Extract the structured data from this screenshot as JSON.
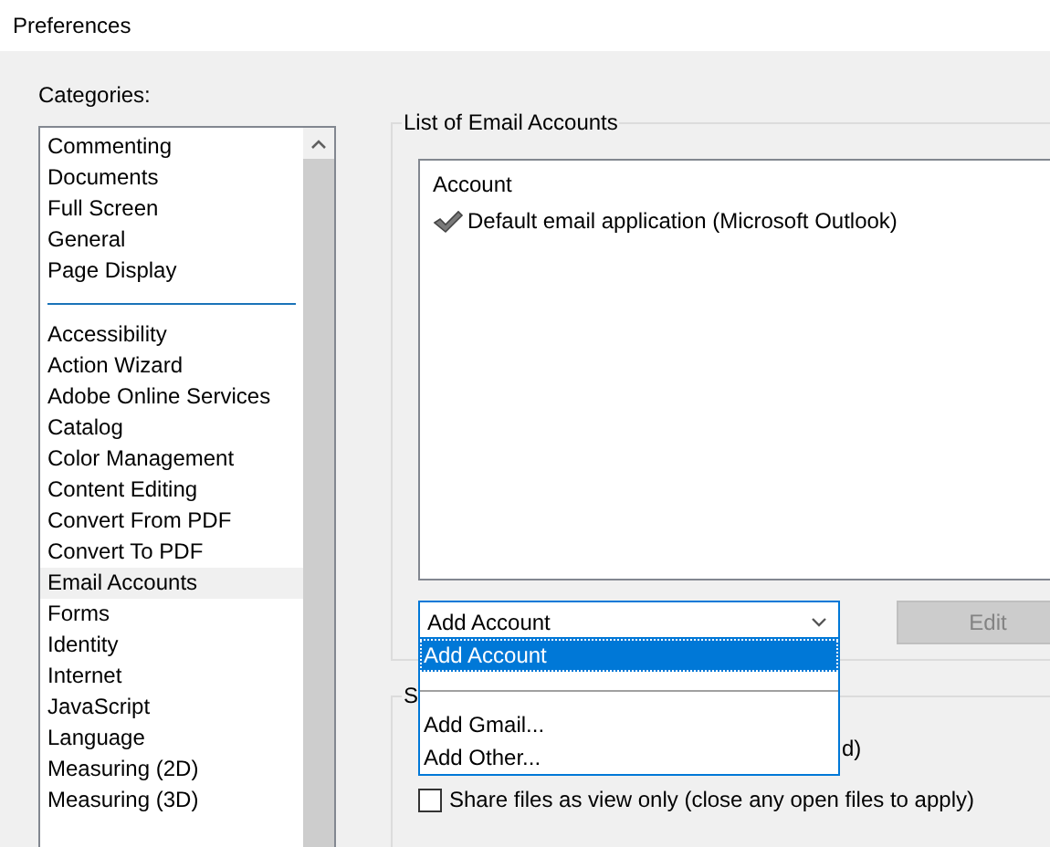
{
  "window": {
    "title": "Preferences"
  },
  "categories": {
    "label": "Categories:",
    "groups": [
      [
        {
          "label": "Commenting",
          "selected": false
        },
        {
          "label": "Documents",
          "selected": false
        },
        {
          "label": "Full Screen",
          "selected": false
        },
        {
          "label": "General",
          "selected": false
        },
        {
          "label": "Page Display",
          "selected": false
        }
      ],
      [
        {
          "label": "Accessibility",
          "selected": false
        },
        {
          "label": "Action Wizard",
          "selected": false
        },
        {
          "label": "Adobe Online Services",
          "selected": false
        },
        {
          "label": "Catalog",
          "selected": false
        },
        {
          "label": "Color Management",
          "selected": false
        },
        {
          "label": "Content Editing",
          "selected": false
        },
        {
          "label": "Convert From PDF",
          "selected": false
        },
        {
          "label": "Convert To PDF",
          "selected": false
        },
        {
          "label": "Email Accounts",
          "selected": true
        },
        {
          "label": "Forms",
          "selected": false
        },
        {
          "label": "Identity",
          "selected": false
        },
        {
          "label": "Internet",
          "selected": false
        },
        {
          "label": "JavaScript",
          "selected": false
        },
        {
          "label": "Language",
          "selected": false
        },
        {
          "label": "Measuring (2D)",
          "selected": false
        },
        {
          "label": "Measuring (3D)",
          "selected": false
        }
      ]
    ]
  },
  "accounts_group": {
    "title": "List of Email Accounts",
    "column": "Account",
    "rows": [
      {
        "label": "Default email application (Microsoft Outlook)",
        "checked": true
      }
    ],
    "dropdown": {
      "value": "Add Account",
      "options": [
        {
          "kind": "item",
          "label": "Add Account",
          "selected": true
        },
        {
          "kind": "blank"
        },
        {
          "kind": "separator"
        },
        {
          "kind": "item",
          "label": "Add Gmail...",
          "selected": false
        },
        {
          "kind": "item",
          "label": "Add Other...",
          "selected": false
        }
      ]
    },
    "edit_button": {
      "label": "Edit",
      "disabled": true
    }
  },
  "second_group": {
    "title": "S",
    "rows": [
      {
        "kind": "fragment",
        "label": "d)"
      },
      {
        "kind": "checkbox",
        "label": "Share files as view only (close any open files to apply)",
        "checked": false
      }
    ]
  }
}
